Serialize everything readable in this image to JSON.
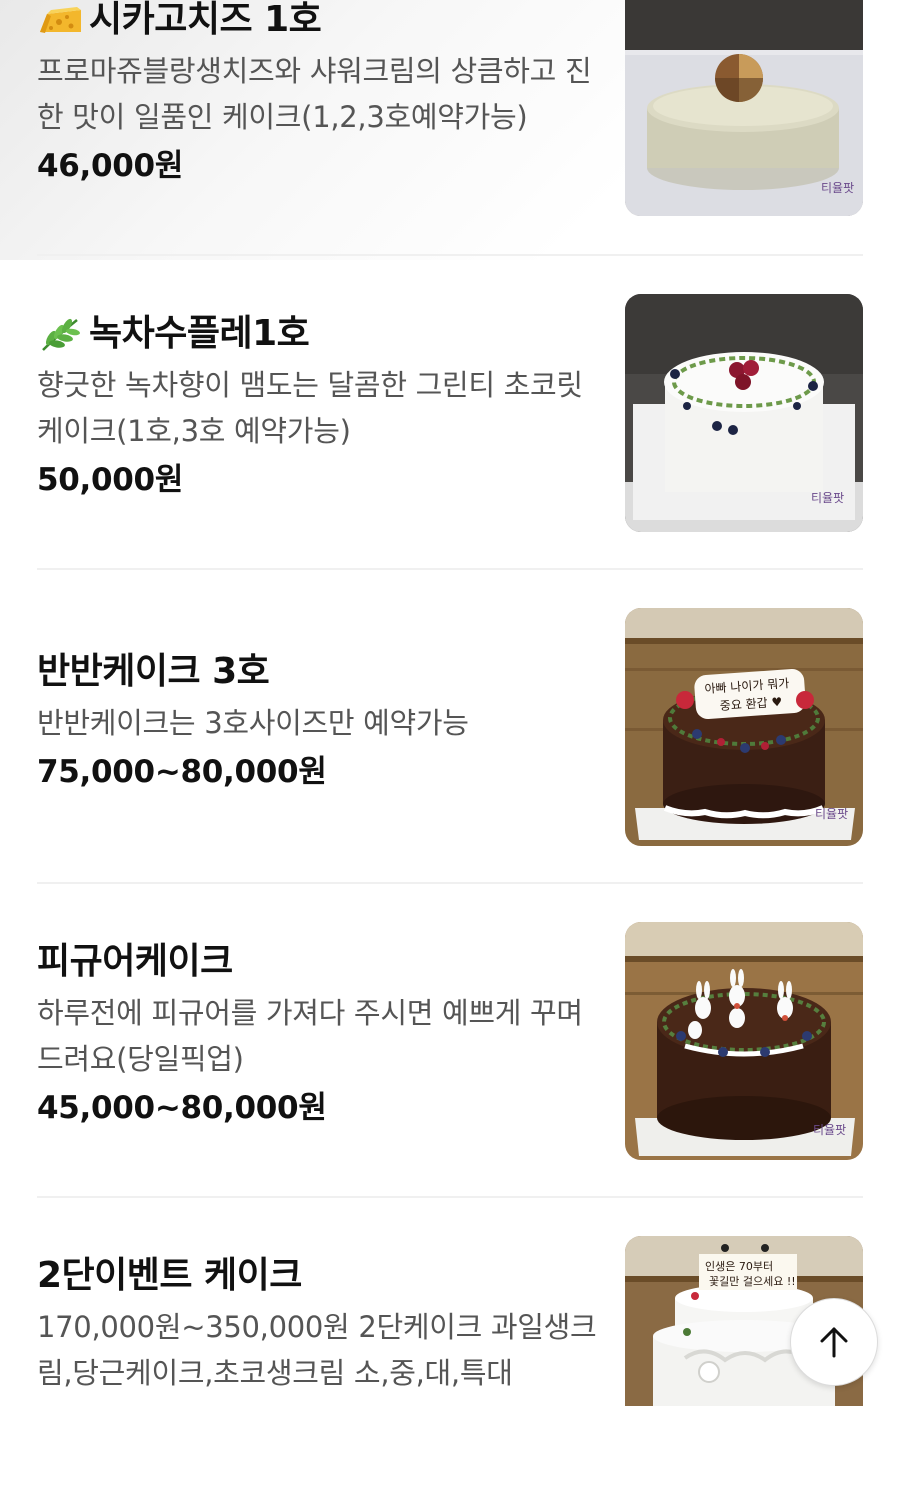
{
  "menu": {
    "items": [
      {
        "icon": "cheese-icon",
        "name": "시카고치즈 1호",
        "description": "프로마쥬블랑생치즈와 샤워크림의 상큼하고 진한 맛이 일품인 케이크(1,2,3호예약가능)",
        "price": "46,000원",
        "image": "cheesecake-photo"
      },
      {
        "icon": "herb-icon",
        "name": "녹차수플레1호",
        "description": "향긋한 녹차향이 맴도는 달콤한 그린티 초코릿 케이크(1호,3호 예약가능)",
        "price": "50,000원",
        "image": "greentea-souffle-photo"
      },
      {
        "icon": "",
        "name": "반반케이크 3호",
        "description": "반반케이크는 3호사이즈만 예약가능",
        "price": "75,000~80,000원",
        "image": "half-half-cake-photo",
        "image_text": "아빠 나이가 뭐가 중요 환갑"
      },
      {
        "icon": "",
        "name": "피규어케이크",
        "description": "하루전에 피규어를 가져다 주시면 예쁘게 꾸며드려요(당일픽업)",
        "price": "45,000~80,000원",
        "image": "figure-cake-photo"
      },
      {
        "icon": "",
        "name": "2단이벤트 케이크",
        "description": "170,000원~350,000원 2단케이크 과일생크림,당근케이크,초코생크림 소,중,대,특대",
        "price": "",
        "image": "two-tier-cake-photo",
        "image_text": "인생은 70부터 꽃길만 걸으세요 !!"
      }
    ]
  },
  "scroll_top_button": {
    "icon": "arrow-up-icon"
  }
}
